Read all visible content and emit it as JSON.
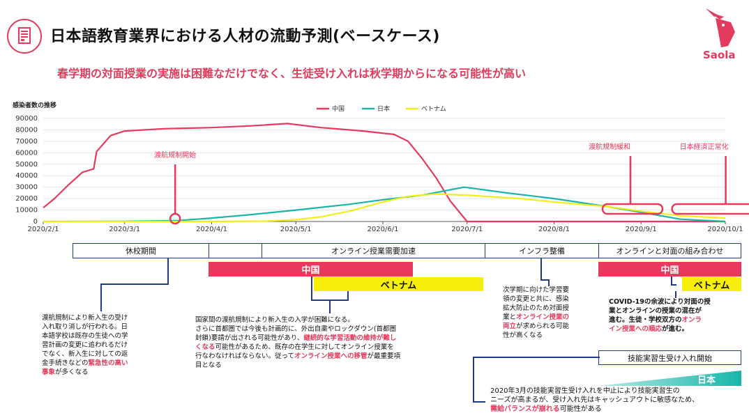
{
  "header": {
    "title": "日本語教育業界における人材の流動予測(ベースケース)",
    "subtitle": "春学期の対面授業の実施は困難なだけでなく、生徒受け入れは秋学期からになる可能性が高い",
    "logo_text": "Saola"
  },
  "chart_data": {
    "type": "line",
    "ylabel": "感染者数の推移",
    "ylim": [
      0,
      90000
    ],
    "yticks": [
      "0",
      "10000",
      "20000",
      "30000",
      "40000",
      "50000",
      "60000",
      "70000",
      "80000",
      "90000"
    ],
    "xticks": [
      "2020/2/1",
      "2020/3/1",
      "2020/4/1",
      "2020/5/1",
      "2020/6/1",
      "2020/7/1",
      "2020/8/1",
      "2020/9/1",
      "2020/10/1"
    ],
    "series": [
      {
        "name": "中国",
        "color": "#e8385d",
        "x": [
          "2020/2/1",
          "2020/2/5",
          "2020/2/10",
          "2020/2/15",
          "2020/2/19",
          "2020/2/20",
          "2020/2/25",
          "2020/3/1",
          "2020/3/15",
          "2020/4/1",
          "2020/4/15",
          "2020/4/28",
          "2020/5/10",
          "2020/5/25",
          "2020/6/5",
          "2020/6/10",
          "2020/6/15",
          "2020/6/20",
          "2020/6/25",
          "2020/7/1",
          "2020/8/1",
          "2020/9/1",
          "2020/10/1"
        ],
        "values": [
          12000,
          20000,
          32000,
          43000,
          46000,
          61000,
          75000,
          79000,
          81000,
          82000,
          83500,
          85500,
          82000,
          79000,
          76000,
          70000,
          55000,
          38000,
          18000,
          0,
          0,
          0,
          0
        ]
      },
      {
        "name": "日本",
        "color": "#1ab5a8",
        "x": [
          "2020/2/1",
          "2020/3/1",
          "2020/3/20",
          "2020/4/1",
          "2020/4/15",
          "2020/5/1",
          "2020/5/20",
          "2020/6/1",
          "2020/6/15",
          "2020/6/30",
          "2020/7/15",
          "2020/8/1",
          "2020/8/20",
          "2020/9/1",
          "2020/9/15",
          "2020/10/1"
        ],
        "values": [
          0,
          200,
          800,
          3000,
          6000,
          10000,
          15000,
          19000,
          23000,
          30000,
          25000,
          20000,
          13000,
          8000,
          2000,
          0
        ]
      },
      {
        "name": "ベトナム",
        "color": "#f3ed1a",
        "x": [
          "2020/2/1",
          "2020/4/1",
          "2020/4/20",
          "2020/5/1",
          "2020/5/10",
          "2020/5/20",
          "2020/6/1",
          "2020/6/10",
          "2020/6/20",
          "2020/7/1",
          "2020/7/20",
          "2020/8/1",
          "2020/8/20",
          "2020/9/1",
          "2020/9/15",
          "2020/10/1"
        ],
        "values": [
          0,
          0,
          300,
          1500,
          4000,
          9000,
          17000,
          22000,
          24000,
          23000,
          20000,
          17000,
          13000,
          9000,
          5000,
          3000
        ]
      }
    ],
    "annotations": [
      {
        "label": "渡航規制開始",
        "x": "2020/3/19"
      },
      {
        "label": "渡航規制緩和",
        "x": "2020/8/20"
      },
      {
        "label": "日本経済正常化",
        "x": "2020/9/15"
      }
    ]
  },
  "phases": [
    {
      "label": "休校期間"
    },
    {
      "label": ""
    },
    {
      "label": "オンライン授業需要加速"
    },
    {
      "label": "インフラ整備"
    },
    {
      "label": "オンラインと対面の組み合わせ"
    }
  ],
  "bars": {
    "china1": "中国",
    "vietnam1": "ベトナム",
    "china2": "中国",
    "vietnam2": "ベトナム",
    "tech_trainee_header": "技能実習生受け入れ開始",
    "japan": "日本"
  },
  "notes": {
    "n1a": "渡航規制により新入生の受け",
    "n1b": "入れ取り消しが行われる。日",
    "n1c": "本語学校は既存の生徒への学",
    "n1d": "習計画の変更に追われるだけ",
    "n1e": "でなく、新入生に対しての返",
    "n1f_pre": "金手続きなどの",
    "n1f_red": "緊急性の高い",
    "n1g_red": "事象",
    "n1g_post": "が多くなる",
    "n2a": "国家間の渡航規制により新入生の入学が困難になる。",
    "n2b": "さらに首都圏では今後も計画的に、外出自粛やロックダウン(首都圏",
    "n2c_pre": "封鎖)要請が出される可能性があり、",
    "n2c_red": "継続的な学習活動の維持が難し",
    "n2d_red": "くなる",
    "n2d_post": "可能性があるため、既存の在学生に対してオンライン授業を",
    "n2e_pre": "行なわなければならない。従って",
    "n2e_red": "オンライン授業への移管",
    "n2e_post": "が最重要項",
    "n2f": "目となる",
    "n3a": "次学期に向けた学習要",
    "n3b": "領の変更と共に、感染",
    "n3c": "拡大防止のため対面授",
    "n3d_pre": "業と",
    "n3d_red": "オンライン授業の",
    "n3e_red": "両立",
    "n3e_post": "が求められる可能",
    "n3f": "性が高くなる",
    "n4a": "COVID-19の余波により対面の授",
    "n4b": "業とオンラインの授業の混在が",
    "n4c_pre": "進む。生徒・学校双方の",
    "n4c_red": "オンラ",
    "n4d_red": "イン授業への順応",
    "n4d_post": "が進む。",
    "n5a": "2020年3月の技能実習生受け入れを中止により技能実習生の",
    "n5b": "ニーズが高まるが、受け入れ先はキャッシュアウトに敏感なため、",
    "n5c_red": "需給バランスが崩れる",
    "n5c_post": "可能性がある"
  }
}
